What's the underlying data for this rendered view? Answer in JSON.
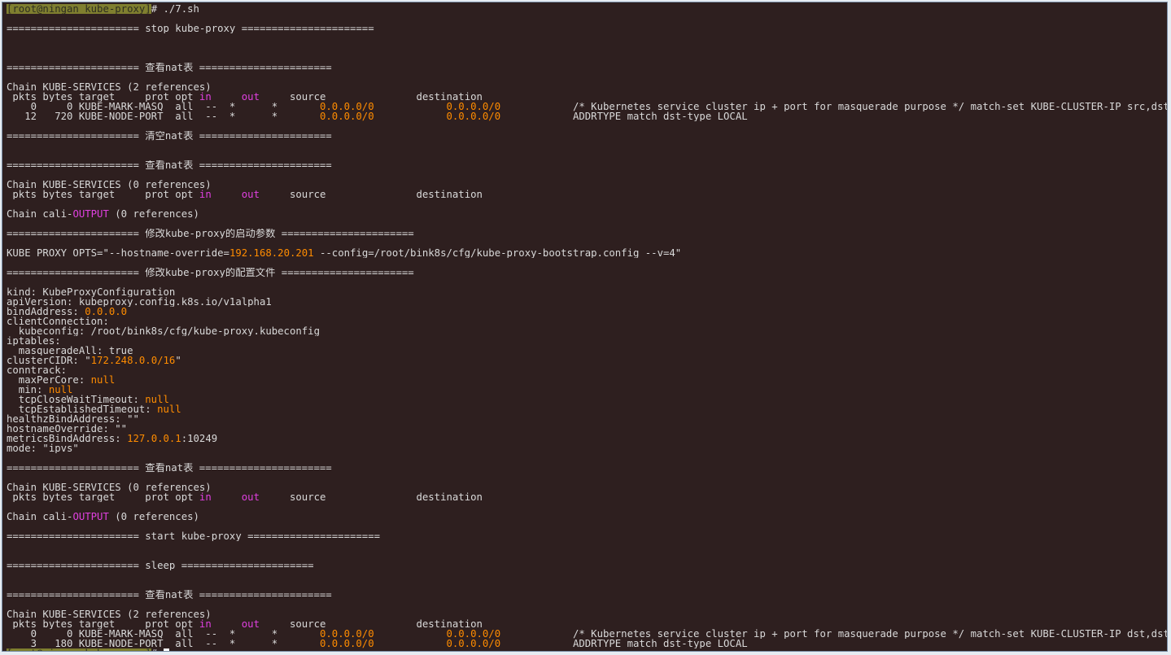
{
  "terminal": {
    "colors": {
      "background": "#2e1f1f",
      "text": "#d9d9d9",
      "prompt_highlight": "#7f7f2f",
      "orange": "#ff8c00",
      "magenta": "#e040e0"
    },
    "lines": [
      {
        "segs": [
          {
            "t": "[root@ningan kube-proxy]",
            "c": "prompt"
          },
          {
            "t": "# ./7.sh"
          }
        ]
      },
      {
        "segs": [
          {
            "t": ""
          }
        ]
      },
      {
        "segs": [
          {
            "t": "====================== stop kube-proxy ======================"
          }
        ]
      },
      {
        "segs": [
          {
            "t": ""
          }
        ]
      },
      {
        "segs": [
          {
            "t": ""
          }
        ]
      },
      {
        "segs": [
          {
            "t": ""
          }
        ]
      },
      {
        "segs": [
          {
            "t": "====================== 查看nat表 ======================"
          }
        ]
      },
      {
        "segs": [
          {
            "t": ""
          }
        ]
      },
      {
        "segs": [
          {
            "t": "Chain KUBE-SERVICES (2 references)"
          }
        ]
      },
      {
        "segs": [
          {
            "t": " pkts bytes target     prot opt "
          },
          {
            "t": "in",
            "c": "magenta"
          },
          {
            "t": "     "
          },
          {
            "t": "out",
            "c": "magenta"
          },
          {
            "t": "     source               destination"
          }
        ]
      },
      {
        "segs": [
          {
            "t": "    0     0 KUBE-MARK-MASQ  all  --  *      *       "
          },
          {
            "t": "0.0.0.0/0",
            "c": "orange"
          },
          {
            "t": "            "
          },
          {
            "t": "0.0.0.0/0",
            "c": "orange"
          },
          {
            "t": "            /* Kubernetes service cluster ip + port for masquerade purpose */ match-set KUBE-CLUSTER-IP src,dst"
          }
        ]
      },
      {
        "segs": [
          {
            "t": "   12   720 KUBE-NODE-PORT  all  --  *      *       "
          },
          {
            "t": "0.0.0.0/0",
            "c": "orange"
          },
          {
            "t": "            "
          },
          {
            "t": "0.0.0.0/0",
            "c": "orange"
          },
          {
            "t": "            ADDRTYPE match dst-type LOCAL"
          }
        ]
      },
      {
        "segs": [
          {
            "t": ""
          }
        ]
      },
      {
        "segs": [
          {
            "t": "====================== 清空nat表 ======================"
          }
        ]
      },
      {
        "segs": [
          {
            "t": ""
          }
        ]
      },
      {
        "segs": [
          {
            "t": ""
          }
        ]
      },
      {
        "segs": [
          {
            "t": "====================== 查看nat表 ======================"
          }
        ]
      },
      {
        "segs": [
          {
            "t": ""
          }
        ]
      },
      {
        "segs": [
          {
            "t": "Chain KUBE-SERVICES (0 references)"
          }
        ]
      },
      {
        "segs": [
          {
            "t": " pkts bytes target     prot opt "
          },
          {
            "t": "in",
            "c": "magenta"
          },
          {
            "t": "     "
          },
          {
            "t": "out",
            "c": "magenta"
          },
          {
            "t": "     source               destination"
          }
        ]
      },
      {
        "segs": [
          {
            "t": ""
          }
        ]
      },
      {
        "segs": [
          {
            "t": "Chain cali-"
          },
          {
            "t": "OUTPUT",
            "c": "magenta"
          },
          {
            "t": " (0 references)"
          }
        ]
      },
      {
        "segs": [
          {
            "t": ""
          }
        ]
      },
      {
        "segs": [
          {
            "t": "====================== 修改kube-proxy的启动参数 ======================"
          }
        ]
      },
      {
        "segs": [
          {
            "t": ""
          }
        ]
      },
      {
        "segs": [
          {
            "t": "KUBE_PROXY_OPTS=\"--hostname-override="
          },
          {
            "t": "192.168.20.201",
            "c": "orange"
          },
          {
            "t": " --config=/root/bink8s/cfg/kube-proxy-bootstrap.config --v=4\""
          }
        ]
      },
      {
        "segs": [
          {
            "t": ""
          }
        ]
      },
      {
        "segs": [
          {
            "t": "====================== 修改kube-proxy的配置文件 ======================"
          }
        ]
      },
      {
        "segs": [
          {
            "t": ""
          }
        ]
      },
      {
        "segs": [
          {
            "t": "kind: KubeProxyConfiguration"
          }
        ]
      },
      {
        "segs": [
          {
            "t": "apiVersion: kubeproxy.config.k8s.io/v1alpha1"
          }
        ]
      },
      {
        "segs": [
          {
            "t": "bindAddress: "
          },
          {
            "t": "0.0.0.0",
            "c": "orange"
          }
        ]
      },
      {
        "segs": [
          {
            "t": "clientConnection:"
          }
        ]
      },
      {
        "segs": [
          {
            "t": "  kubeconfig: /root/bink8s/cfg/kube-proxy.kubeconfig"
          }
        ]
      },
      {
        "segs": [
          {
            "t": "iptables:"
          }
        ]
      },
      {
        "segs": [
          {
            "t": "  masqueradeAll: true"
          }
        ]
      },
      {
        "segs": [
          {
            "t": "clusterCIDR: \""
          },
          {
            "t": "172.248.0.0/16",
            "c": "orange"
          },
          {
            "t": "\""
          }
        ]
      },
      {
        "segs": [
          {
            "t": "conntrack:"
          }
        ]
      },
      {
        "segs": [
          {
            "t": "  maxPerCore: "
          },
          {
            "t": "null",
            "c": "orange"
          }
        ]
      },
      {
        "segs": [
          {
            "t": "  min: "
          },
          {
            "t": "null",
            "c": "orange"
          }
        ]
      },
      {
        "segs": [
          {
            "t": "  tcpCloseWaitTimeout: "
          },
          {
            "t": "null",
            "c": "orange"
          }
        ]
      },
      {
        "segs": [
          {
            "t": "  tcpEstablishedTimeout: "
          },
          {
            "t": "null",
            "c": "orange"
          }
        ]
      },
      {
        "segs": [
          {
            "t": "healthzBindAddress: \"\""
          }
        ]
      },
      {
        "segs": [
          {
            "t": "hostnameOverride: \"\""
          }
        ]
      },
      {
        "segs": [
          {
            "t": "metricsBindAddress: "
          },
          {
            "t": "127.0.0.1",
            "c": "orange"
          },
          {
            "t": ":10249"
          }
        ]
      },
      {
        "segs": [
          {
            "t": "mode: \"ipvs\""
          }
        ]
      },
      {
        "segs": [
          {
            "t": ""
          }
        ]
      },
      {
        "segs": [
          {
            "t": "====================== 查看nat表 ======================"
          }
        ]
      },
      {
        "segs": [
          {
            "t": ""
          }
        ]
      },
      {
        "segs": [
          {
            "t": "Chain KUBE-SERVICES (0 references)"
          }
        ]
      },
      {
        "segs": [
          {
            "t": " pkts bytes target     prot opt "
          },
          {
            "t": "in",
            "c": "magenta"
          },
          {
            "t": "     "
          },
          {
            "t": "out",
            "c": "magenta"
          },
          {
            "t": "     source               destination"
          }
        ]
      },
      {
        "segs": [
          {
            "t": ""
          }
        ]
      },
      {
        "segs": [
          {
            "t": "Chain cali-"
          },
          {
            "t": "OUTPUT",
            "c": "magenta"
          },
          {
            "t": " (0 references)"
          }
        ]
      },
      {
        "segs": [
          {
            "t": ""
          }
        ]
      },
      {
        "segs": [
          {
            "t": "====================== start kube-proxy ======================"
          }
        ]
      },
      {
        "segs": [
          {
            "t": ""
          }
        ]
      },
      {
        "segs": [
          {
            "t": ""
          }
        ]
      },
      {
        "segs": [
          {
            "t": "====================== sleep ======================"
          }
        ]
      },
      {
        "segs": [
          {
            "t": ""
          }
        ]
      },
      {
        "segs": [
          {
            "t": ""
          }
        ]
      },
      {
        "segs": [
          {
            "t": "====================== 查看nat表 ======================"
          }
        ]
      },
      {
        "segs": [
          {
            "t": ""
          }
        ]
      },
      {
        "segs": [
          {
            "t": "Chain KUBE-SERVICES (2 references)"
          }
        ]
      },
      {
        "segs": [
          {
            "t": " pkts bytes target     prot opt "
          },
          {
            "t": "in",
            "c": "magenta"
          },
          {
            "t": "     "
          },
          {
            "t": "out",
            "c": "magenta"
          },
          {
            "t": "     source               destination"
          }
        ]
      },
      {
        "segs": [
          {
            "t": "    0     0 KUBE-MARK-MASQ  all  --  *      *       "
          },
          {
            "t": "0.0.0.0/0",
            "c": "orange"
          },
          {
            "t": "            "
          },
          {
            "t": "0.0.0.0/0",
            "c": "orange"
          },
          {
            "t": "            /* Kubernetes service cluster ip + port for masquerade purpose */ match-set KUBE-CLUSTER-IP dst,dst"
          }
        ]
      },
      {
        "segs": [
          {
            "t": "    3   180 KUBE-NODE-PORT  all  --  *      *       "
          },
          {
            "t": "0.0.0.0/0",
            "c": "orange"
          },
          {
            "t": "            "
          },
          {
            "t": "0.0.0.0/0",
            "c": "orange"
          },
          {
            "t": "            ADDRTYPE match dst-type LOCAL"
          }
        ]
      },
      {
        "segs": [
          {
            "t": "[root@ningan kube-proxy]",
            "c": "prompt"
          },
          {
            "t": "# "
          },
          {
            "t": " ",
            "c": "cursor"
          }
        ]
      }
    ]
  }
}
